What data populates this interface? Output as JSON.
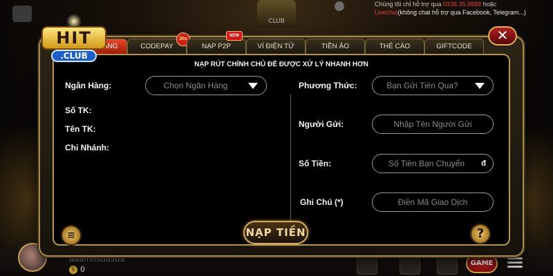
{
  "colors": {
    "accent_gold": "#b59850",
    "tab_active": "#e84a28",
    "close_red": "#b02020",
    "support_red": "#e04040"
  },
  "top_bar": {
    "support_line1": "Chúng tôi chỉ hỗ trợ qua",
    "support_phone": "0338.35.8888",
    "support_line1_suffix": "hoặc",
    "livechat_label": "Livechat",
    "livechat_note": "(không chat hỗ trợ qua Facebook, Telegram...)",
    "logo_sub": "CLUB"
  },
  "logo": {
    "hit": "HIT",
    "club": ".CLUB"
  },
  "tabs": [
    {
      "label": "HÀNG",
      "active": true
    },
    {
      "label": "CODEPAY",
      "badge": "30s"
    },
    {
      "label": "NẠP P2P",
      "badge": "NEW"
    },
    {
      "label": "VÍ ĐIỆN TỬ"
    },
    {
      "label": "TIỀN ẢO"
    },
    {
      "label": "THẺ CÀO"
    },
    {
      "label": "GIFTCODE"
    }
  ],
  "close_icon": "close-icon",
  "form": {
    "title": "NẠP RÚT CHÍNH CHỦ ĐỂ ĐƯỢC XỬ LÝ NHANH HƠN",
    "bank_label": "Ngân Hàng:",
    "bank_select": "Chọn Ngân Hàng",
    "account_no_label": "Số TK:",
    "account_name_label": "Tên TK:",
    "branch_label": "Chi Nhánh:",
    "method_label": "Phương Thức:",
    "method_select": "Bạn Gửi Tiền Qua?",
    "sender_label": "Người Gửi:",
    "sender_placeholder": "Nhập Tên Người Gửi",
    "amount_label": "Số Tiền:",
    "amount_placeholder": "Số Tiền Bạn Chuyển",
    "amount_suffix": "đ",
    "note_label": "Ghi Chú (*)",
    "note_placeholder": "Điền Mã Giao Dịch",
    "submit": "NẠP TIỀN",
    "help": "?"
  },
  "bottom": {
    "username": "aaamnsdasda",
    "balance": "0",
    "balance_icon": "$",
    "game_button": "GAME"
  }
}
